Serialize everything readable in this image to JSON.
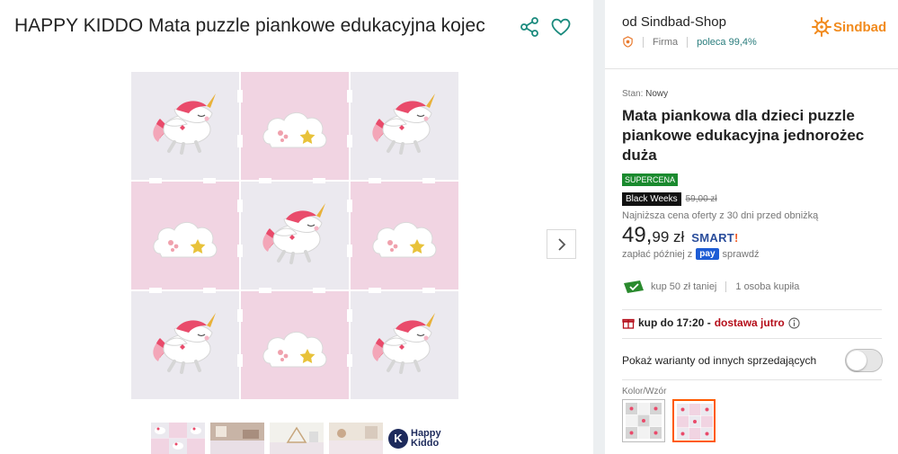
{
  "product": {
    "title": "HAPPY KIDDO Mata puzzle piankowe edukacyjna kojec"
  },
  "icons": {
    "share": "share-icon",
    "favorite": "heart-icon",
    "next": "chevron-right-icon"
  },
  "thumbnails": [
    {
      "name": "thumb-pattern"
    },
    {
      "name": "thumb-room-1"
    },
    {
      "name": "thumb-room-2"
    },
    {
      "name": "thumb-room-3"
    },
    {
      "name": "thumb-brand-logo",
      "logo_letter": "K",
      "logo_line1": "Happy",
      "logo_line2": "Kiddo"
    }
  ],
  "seller": {
    "name": "od Sindbad-Shop",
    "type": "Firma",
    "recommend": "poleca 99,4%",
    "brand": "Sindbad"
  },
  "offer": {
    "condition_label": "Stan:",
    "condition_value": "Nowy",
    "title": "Mata piankowa dla dzieci puzzle piankowe edukacyjna jednorożec duża",
    "badge_super": "SUPERCENA",
    "badge_event": "Black Weeks",
    "old_price": "59,00 zł",
    "lowest_note": "Najniższa cena oferty z 30 dni przed obniżką",
    "price_main": "49,",
    "price_cents": "99 zł",
    "smart_label": "SMART",
    "smart_mark": "!",
    "pay_later": "zapłać później z",
    "pay_badge": "pay",
    "pay_check": "sprawdź",
    "promo_cheaper": "kup 50 zł taniej",
    "promo_bought": "1 osoba kupiła",
    "delivery_prefix": "kup do 17:20 -",
    "delivery_suffix": "dostawa jutro",
    "variants_label": "Pokaż warianty od innych sprzedających",
    "color_label": "Kolor/Wzór"
  },
  "colors": {
    "accent_orange": "#ff5a00",
    "brand_orange": "#f18a1c",
    "super_green": "#1a8a2e",
    "delivery_red": "#b50e1a",
    "pink_tile": "#f1d4e2",
    "grey_tile": "#ebe9ef"
  }
}
